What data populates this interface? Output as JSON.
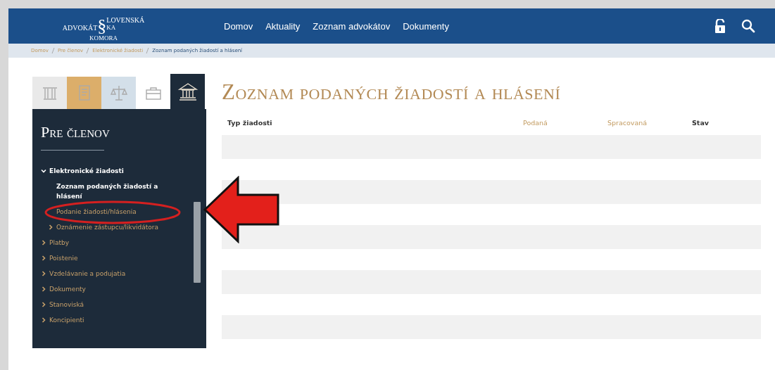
{
  "logo": {
    "top": "LOVENSKÁ",
    "mark": "§",
    "left": "ADVOKÁT",
    "right": "KA",
    "bottom": "KOMORA"
  },
  "nav": [
    "Domov",
    "Aktuality",
    "Zoznam advokátov",
    "Dokumenty"
  ],
  "breadcrumb": [
    {
      "label": "Domov",
      "current": false
    },
    {
      "label": "Pre členov",
      "current": false
    },
    {
      "label": "Elektronické žiadosti",
      "current": false
    },
    {
      "label": "Zoznam podaných žiadostí a hlásení",
      "current": true
    }
  ],
  "sidebar": {
    "tabs": [
      {
        "kind": "columns",
        "color": "#e9e9e9",
        "selected": false
      },
      {
        "kind": "book",
        "color": "#dcae6a",
        "selected": false
      },
      {
        "kind": "scales",
        "color": "#d3dfe9",
        "selected": false
      },
      {
        "kind": "briefcase",
        "color": "#ffffff",
        "selected": false
      },
      {
        "kind": "building",
        "color": "#1d2b3a",
        "selected": true
      }
    ],
    "title": "Pre členov",
    "items": [
      {
        "label": "Elektronické žiadosti",
        "expanded": true,
        "children": [
          {
            "label": "Zoznam podaných žiadostí a hlásení",
            "selected": true
          },
          {
            "label": "Podanie žiadosti/hlásenia",
            "selected": false
          },
          {
            "label": "Oznámenie zástupcu/likvidátora",
            "selected": false,
            "expanded": false
          }
        ]
      },
      {
        "label": "Platby",
        "expanded": false
      },
      {
        "label": "Poistenie",
        "expanded": false
      },
      {
        "label": "Vzdelávanie a podujatia",
        "expanded": false
      },
      {
        "label": "Dokumenty",
        "expanded": false
      },
      {
        "label": "Stanoviská",
        "expanded": false
      },
      {
        "label": "Koncipienti",
        "expanded": false
      }
    ]
  },
  "page_title": "Zoznam podaných žiadostí a hlásení",
  "table": {
    "columns": [
      {
        "label": "Typ žiadosti",
        "kind": "plain"
      },
      {
        "label": "Podaná",
        "kind": "sortable"
      },
      {
        "label": "Spracovaná",
        "kind": "sortable"
      },
      {
        "label": "Stav",
        "kind": "plain"
      }
    ]
  }
}
